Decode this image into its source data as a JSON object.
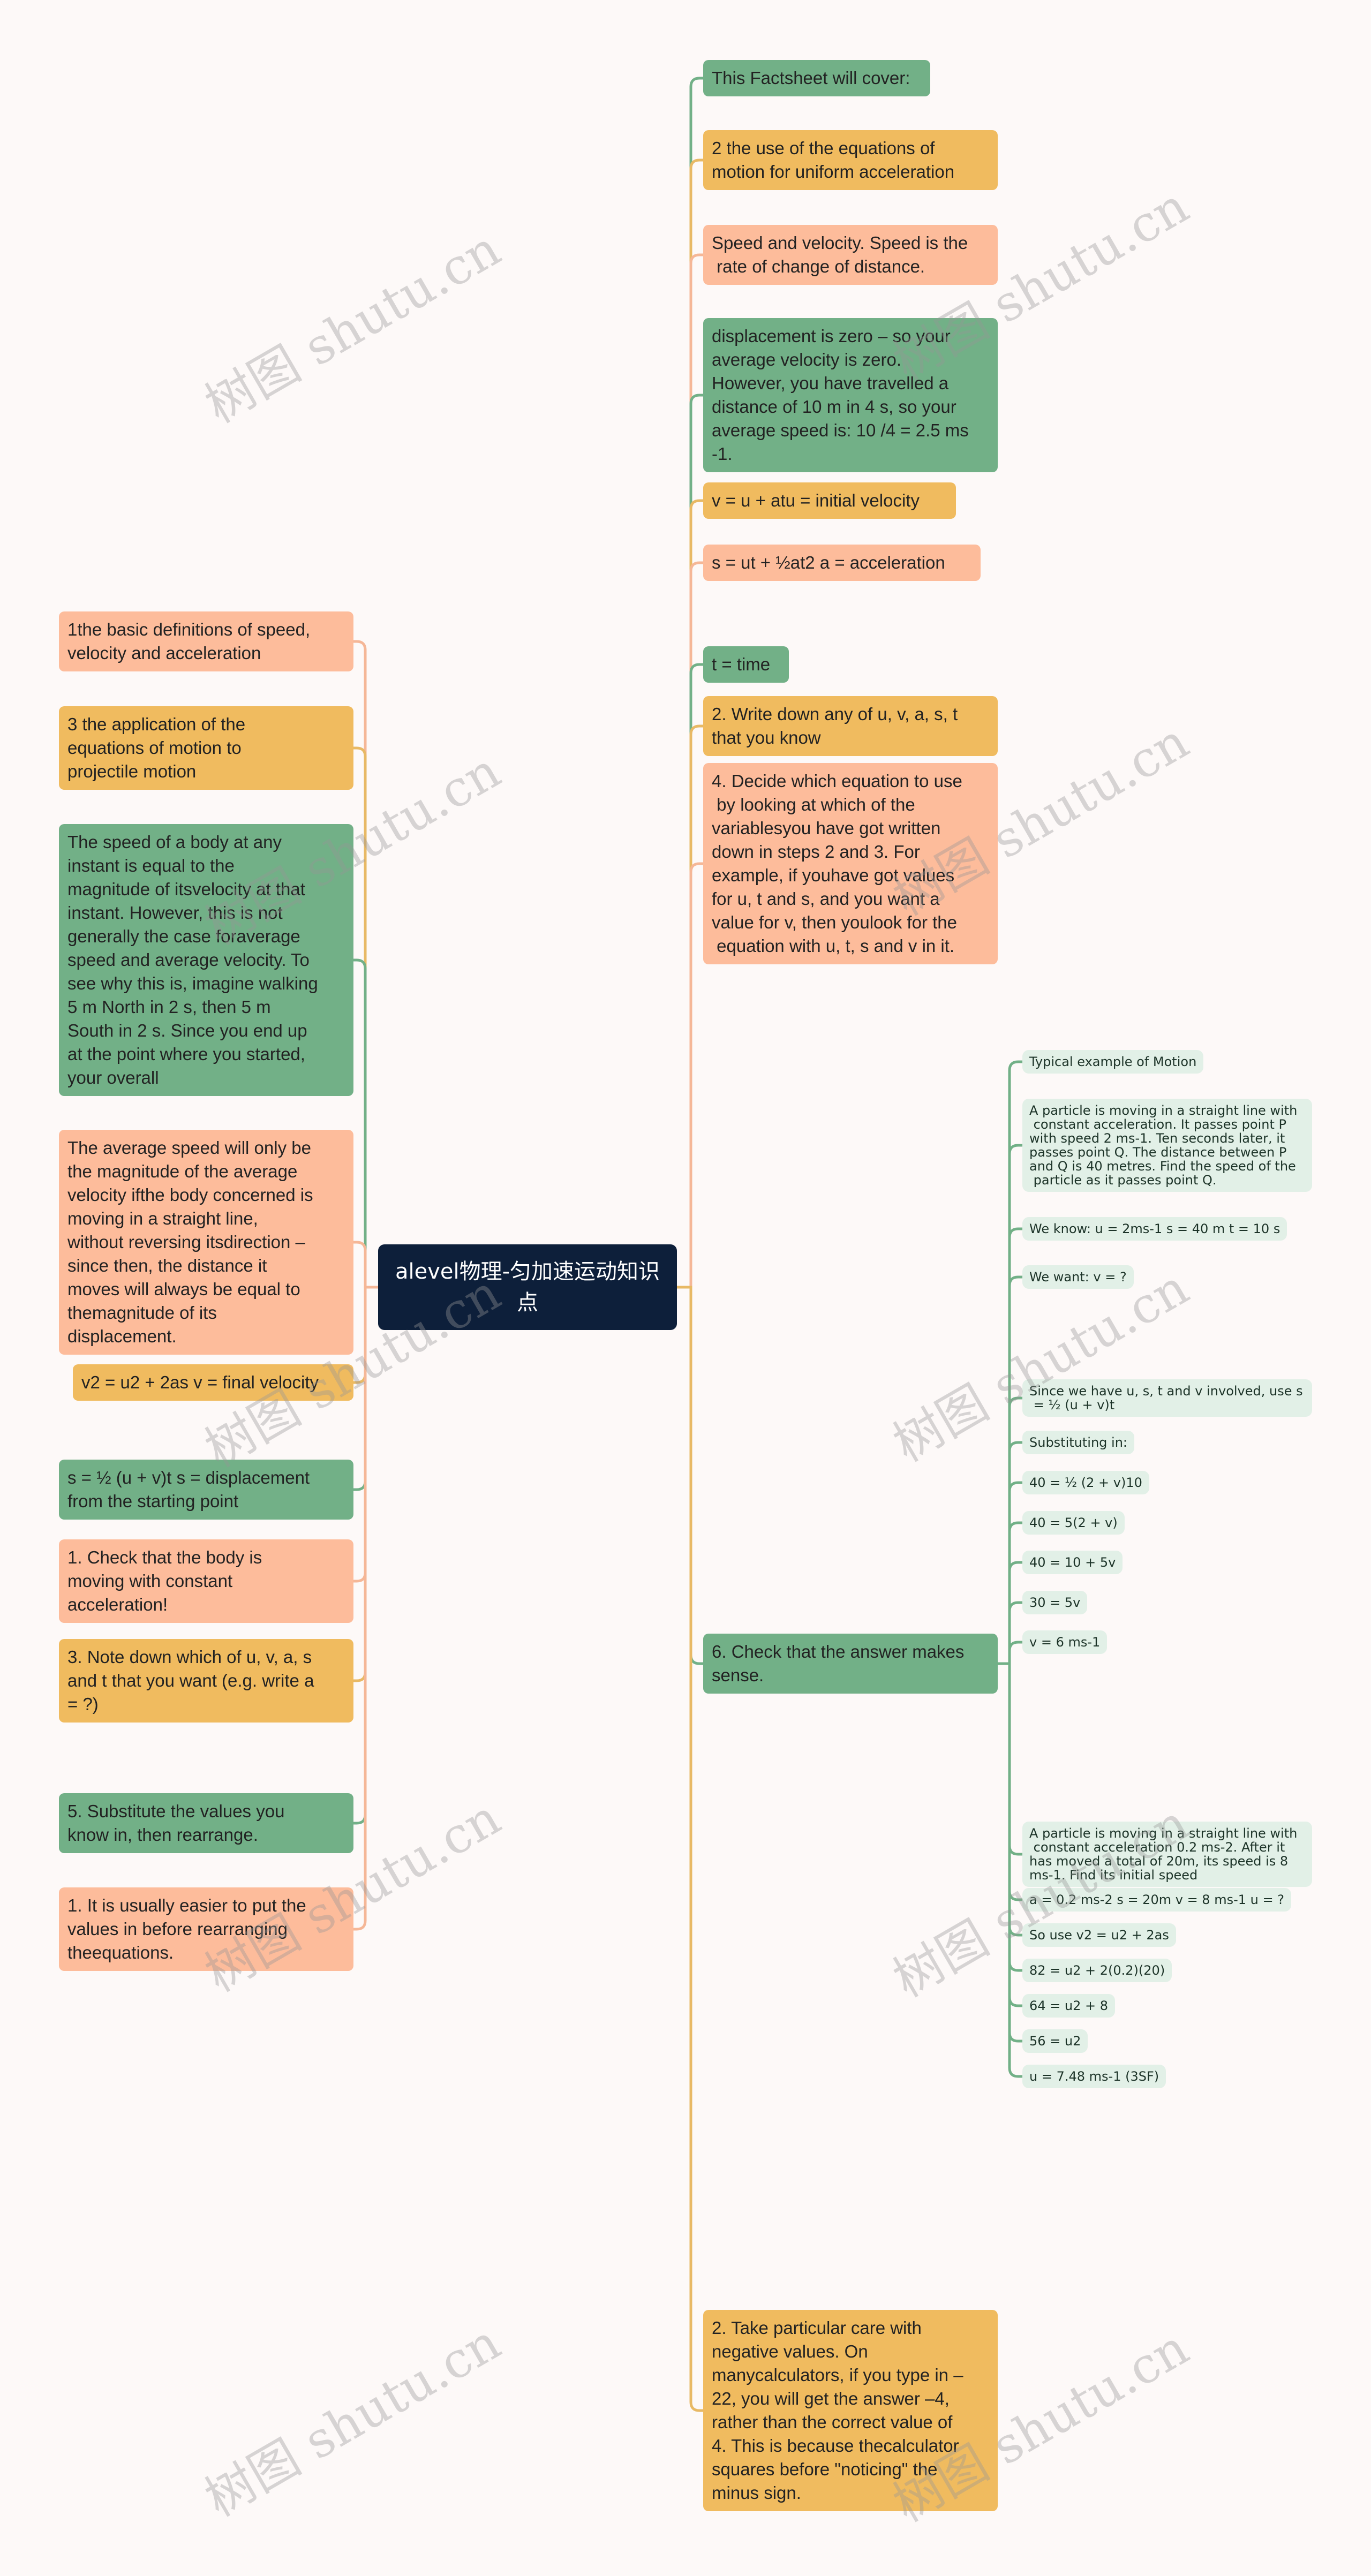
{
  "root": {
    "title": "alevel物理-匀加速运动知识点"
  },
  "colors": {
    "background": "#fdf9f8",
    "root": "#0d1f3a",
    "green": "#72b087",
    "yellow": "#f0bb5f",
    "salmon": "#fdbc9b",
    "leaf": "#e2f0e7",
    "link_green": "#72b087",
    "link_yellow": "#e8b965",
    "link_salmon": "#f5b797"
  },
  "right_branches": [
    {
      "text": "This Factsheet will cover:",
      "color": "green"
    },
    {
      "text": "2 the use of the equations of\nmotion for uniform acceleration",
      "color": "yellow"
    },
    {
      "text": "Speed and velocity. Speed is the\n rate of change of distance.",
      "color": "salmon"
    },
    {
      "text": "displacement is zero – so your\naverage velocity is zero.\nHowever, you have travelled a\ndistance of 10 m in 4 s, so your\naverage speed is: 10 /4 = 2.5 ms\n-1.",
      "color": "green"
    },
    {
      "text": "v = u + atu = initial velocity",
      "color": "yellow"
    },
    {
      "text": "s = ut + ½at2 a = acceleration",
      "color": "salmon"
    },
    {
      "text": "t = time",
      "color": "green"
    },
    {
      "text": "2. Write down any of u, v, a, s, t\nthat you know",
      "color": "yellow"
    },
    {
      "text": "4. Decide which equation to use\n by looking at which of the\nvariablesyou have got written\ndown in steps 2 and 3. For\nexample, if youhave got values\nfor u, t and s, and you want a\nvalue for v, then youlook for the\n equation with u, t, s and v in it.",
      "color": "salmon"
    },
    {
      "text": "6. Check that the answer makes\nsense.",
      "color": "green"
    },
    {
      "text": "2. Take particular care with\nnegative values. On\nmanycalculators, if you type in –\n22, you will get the answer –4,\nrather than the correct value of\n4. This is because thecalculator\nsquares before \"noticing\" the\nminus sign.",
      "color": "yellow"
    }
  ],
  "left_branches": [
    {
      "text": "1the basic definitions of speed,\nvelocity and acceleration",
      "color": "salmon"
    },
    {
      "text": "3 the application of the\nequations of motion to\nprojectile motion",
      "color": "yellow"
    },
    {
      "text": "The speed of a body at any\ninstant is equal to the\nmagnitude of itsvelocity at that\ninstant. However, this is not\ngenerally the case foraverage\nspeed and average velocity. To\nsee why this is, imagine walking\n5 m North in 2 s, then 5 m\nSouth in 2 s. Since you end up\nat the point where you started,\nyour overall",
      "color": "green"
    },
    {
      "text": "The average speed will only be\nthe magnitude of the average\nvelocity ifthe body concerned is\nmoving in a straight line,\nwithout reversing itsdirection –\nsince then, the distance it\nmoves will always be equal to\nthemagnitude of its\ndisplacement.",
      "color": "salmon"
    },
    {
      "text": "v2 = u2 + 2as v = final velocity",
      "color": "yellow"
    },
    {
      "text": "s = ½ (u + v)t s = displacement\nfrom the starting point",
      "color": "green"
    },
    {
      "text": "1. Check that the body is\nmoving with constant\nacceleration!",
      "color": "salmon"
    },
    {
      "text": "3. Note down which of u, v, a, s\nand t that you want (e.g. write a\n= ?)",
      "color": "yellow"
    },
    {
      "text": "5. Substitute the values you\nknow in, then rearrange.",
      "color": "green"
    },
    {
      "text": "1. It is usually easier to put the\nvalues in before rearranging\ntheequations.",
      "color": "salmon"
    }
  ],
  "check_answer_children": [
    {
      "text": "Typical example of Motion"
    },
    {
      "text": "A particle is moving in a straight line with\n constant acceleration. It passes point P\nwith speed 2 ms-1. Ten seconds later, it\npasses point Q. The distance between P\nand Q is 40 metres. Find the speed of the\n particle as it passes point Q."
    },
    {
      "text": "We know: u = 2ms-1 s = 40 m t = 10 s"
    },
    {
      "text": "We want: v = ?"
    },
    {
      "text": "Since we have u, s, t and v involved, use s\n = ½ (u + v)t"
    },
    {
      "text": "Substituting in:"
    },
    {
      "text": "40 = ½ (2 + v)10"
    },
    {
      "text": "40 = 5(2 + v)"
    },
    {
      "text": "40 = 10 + 5v"
    },
    {
      "text": "30 = 5v"
    },
    {
      "text": "v = 6 ms-1"
    },
    {
      "text": "A particle is moving in a straight line with\n constant acceleration 0.2 ms-2. After it\nhas moved a total of 20m, its speed is 8\nms-1. Find its initial speed"
    },
    {
      "text": "a = 0.2 ms-2 s = 20m v = 8 ms-1 u = ?"
    },
    {
      "text": "So use v2 = u2 + 2as"
    },
    {
      "text": "82 = u2 + 2(0.2)(20)"
    },
    {
      "text": "64 = u2 + 8"
    },
    {
      "text": "56 = u2"
    },
    {
      "text": "u = 7.48 ms-1 (3SF)"
    }
  ],
  "watermark": {
    "text": "树图 shutu.cn"
  }
}
